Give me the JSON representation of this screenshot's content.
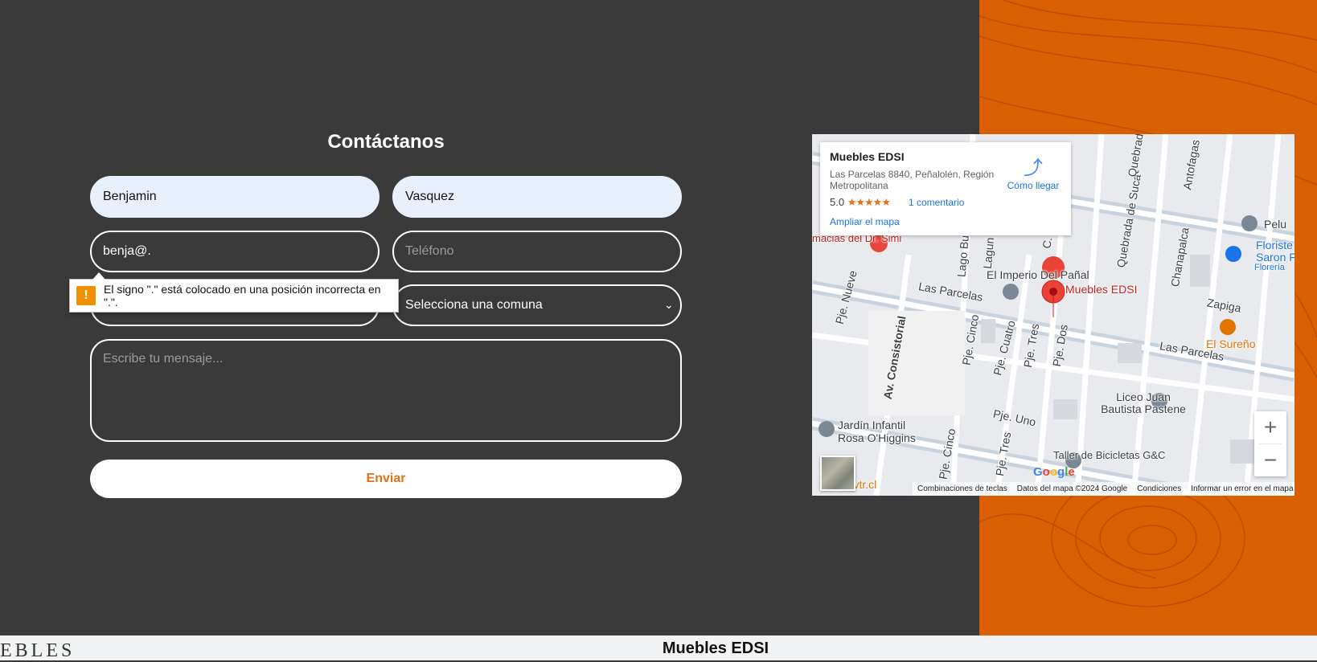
{
  "contact": {
    "title": "Contáctanos",
    "first_name_value": "Benjamin",
    "last_name_value": "Vasquez",
    "email_value": "benja@.",
    "phone_placeholder": "Teléfono",
    "comuna_selected": "Selecciona una comuna",
    "message_placeholder": "Escribe tu mensaje...",
    "submit_label": "Enviar",
    "validation_tooltip": "El signo \".\" está colocado en una posición incorrecta en \".\"."
  },
  "map": {
    "place_name": "Muebles EDSI",
    "address": "Las Parcelas 8840, Peñalolén, Región Metropolitana",
    "rating": "5.0",
    "stars": "★★★★★",
    "reviews": "1 comentario",
    "enlarge": "Ampliar el mapa",
    "directions": "Cómo llegar",
    "labels": {
      "pharmacy": "macias del Dr. Simi",
      "imperio": "El Imperio Del Pañal",
      "pin": "Muebles EDSI",
      "parcelas1": "Las Parcelas",
      "parcelas2": "Las Parcelas",
      "zapiga": "Zapiga",
      "sureno": "El Sureño",
      "liceo": "Liceo Juan Bautista Pastene",
      "jardin1": "Jardín Infantil",
      "jardin2": "Rosa O'Higgins",
      "floristeria1": "Floriste",
      "floristeria2": "Saron F",
      "floreria": "Florería",
      "pelu": "Pelu",
      "taller": "Taller de Bicicletas G&C",
      "vtr": "www.vtr.cl",
      "consistorial": "Av. Consistorial",
      "nueve": "Pje. Nueve",
      "cinco": "Pje. Cinco",
      "cuatro": "Pje. Cuatro",
      "tres": "Pje. Tres",
      "dos": "Pje. Dos",
      "uno": "Pje. Uno",
      "cinco2": "Pje. Cinco",
      "tres2": "Pje. Tres",
      "lago": "Lago Bud",
      "lagun": "Lagun",
      "quebrada": "Quebrada de Suca",
      "quebrad": "Quebrad",
      "chanapalca": "Chanapalca",
      "antofagas": "Antofagas",
      "diez": "C. Die"
    },
    "attribution": [
      "Combinaciones de teclas",
      "Datos del mapa ©2024 Google",
      "Condiciones",
      "Informar un error en el mapa"
    ],
    "google": "Google"
  },
  "footer": {
    "brand": "Muebles EDSI",
    "logo_fragment": "EBLES"
  },
  "colors": {
    "orange": "#d95f02",
    "dark": "#3a3a3a"
  }
}
